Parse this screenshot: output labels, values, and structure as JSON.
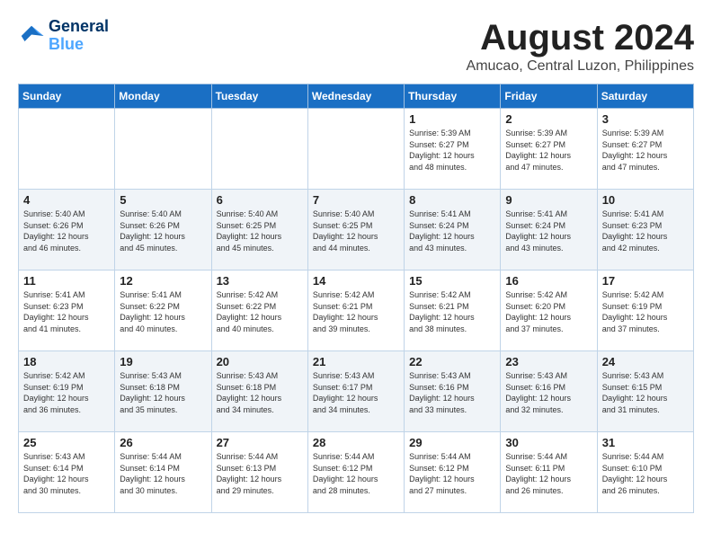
{
  "logo": {
    "line1": "General",
    "line2": "Blue"
  },
  "title": "August 2024",
  "subtitle": "Amucao, Central Luzon, Philippines",
  "headers": [
    "Sunday",
    "Monday",
    "Tuesday",
    "Wednesday",
    "Thursday",
    "Friday",
    "Saturday"
  ],
  "weeks": [
    [
      {
        "day": "",
        "info": ""
      },
      {
        "day": "",
        "info": ""
      },
      {
        "day": "",
        "info": ""
      },
      {
        "day": "",
        "info": ""
      },
      {
        "day": "1",
        "info": "Sunrise: 5:39 AM\nSunset: 6:27 PM\nDaylight: 12 hours\nand 48 minutes."
      },
      {
        "day": "2",
        "info": "Sunrise: 5:39 AM\nSunset: 6:27 PM\nDaylight: 12 hours\nand 47 minutes."
      },
      {
        "day": "3",
        "info": "Sunrise: 5:39 AM\nSunset: 6:27 PM\nDaylight: 12 hours\nand 47 minutes."
      }
    ],
    [
      {
        "day": "4",
        "info": "Sunrise: 5:40 AM\nSunset: 6:26 PM\nDaylight: 12 hours\nand 46 minutes."
      },
      {
        "day": "5",
        "info": "Sunrise: 5:40 AM\nSunset: 6:26 PM\nDaylight: 12 hours\nand 45 minutes."
      },
      {
        "day": "6",
        "info": "Sunrise: 5:40 AM\nSunset: 6:25 PM\nDaylight: 12 hours\nand 45 minutes."
      },
      {
        "day": "7",
        "info": "Sunrise: 5:40 AM\nSunset: 6:25 PM\nDaylight: 12 hours\nand 44 minutes."
      },
      {
        "day": "8",
        "info": "Sunrise: 5:41 AM\nSunset: 6:24 PM\nDaylight: 12 hours\nand 43 minutes."
      },
      {
        "day": "9",
        "info": "Sunrise: 5:41 AM\nSunset: 6:24 PM\nDaylight: 12 hours\nand 43 minutes."
      },
      {
        "day": "10",
        "info": "Sunrise: 5:41 AM\nSunset: 6:23 PM\nDaylight: 12 hours\nand 42 minutes."
      }
    ],
    [
      {
        "day": "11",
        "info": "Sunrise: 5:41 AM\nSunset: 6:23 PM\nDaylight: 12 hours\nand 41 minutes."
      },
      {
        "day": "12",
        "info": "Sunrise: 5:41 AM\nSunset: 6:22 PM\nDaylight: 12 hours\nand 40 minutes."
      },
      {
        "day": "13",
        "info": "Sunrise: 5:42 AM\nSunset: 6:22 PM\nDaylight: 12 hours\nand 40 minutes."
      },
      {
        "day": "14",
        "info": "Sunrise: 5:42 AM\nSunset: 6:21 PM\nDaylight: 12 hours\nand 39 minutes."
      },
      {
        "day": "15",
        "info": "Sunrise: 5:42 AM\nSunset: 6:21 PM\nDaylight: 12 hours\nand 38 minutes."
      },
      {
        "day": "16",
        "info": "Sunrise: 5:42 AM\nSunset: 6:20 PM\nDaylight: 12 hours\nand 37 minutes."
      },
      {
        "day": "17",
        "info": "Sunrise: 5:42 AM\nSunset: 6:19 PM\nDaylight: 12 hours\nand 37 minutes."
      }
    ],
    [
      {
        "day": "18",
        "info": "Sunrise: 5:42 AM\nSunset: 6:19 PM\nDaylight: 12 hours\nand 36 minutes."
      },
      {
        "day": "19",
        "info": "Sunrise: 5:43 AM\nSunset: 6:18 PM\nDaylight: 12 hours\nand 35 minutes."
      },
      {
        "day": "20",
        "info": "Sunrise: 5:43 AM\nSunset: 6:18 PM\nDaylight: 12 hours\nand 34 minutes."
      },
      {
        "day": "21",
        "info": "Sunrise: 5:43 AM\nSunset: 6:17 PM\nDaylight: 12 hours\nand 34 minutes."
      },
      {
        "day": "22",
        "info": "Sunrise: 5:43 AM\nSunset: 6:16 PM\nDaylight: 12 hours\nand 33 minutes."
      },
      {
        "day": "23",
        "info": "Sunrise: 5:43 AM\nSunset: 6:16 PM\nDaylight: 12 hours\nand 32 minutes."
      },
      {
        "day": "24",
        "info": "Sunrise: 5:43 AM\nSunset: 6:15 PM\nDaylight: 12 hours\nand 31 minutes."
      }
    ],
    [
      {
        "day": "25",
        "info": "Sunrise: 5:43 AM\nSunset: 6:14 PM\nDaylight: 12 hours\nand 30 minutes."
      },
      {
        "day": "26",
        "info": "Sunrise: 5:44 AM\nSunset: 6:14 PM\nDaylight: 12 hours\nand 30 minutes."
      },
      {
        "day": "27",
        "info": "Sunrise: 5:44 AM\nSunset: 6:13 PM\nDaylight: 12 hours\nand 29 minutes."
      },
      {
        "day": "28",
        "info": "Sunrise: 5:44 AM\nSunset: 6:12 PM\nDaylight: 12 hours\nand 28 minutes."
      },
      {
        "day": "29",
        "info": "Sunrise: 5:44 AM\nSunset: 6:12 PM\nDaylight: 12 hours\nand 27 minutes."
      },
      {
        "day": "30",
        "info": "Sunrise: 5:44 AM\nSunset: 6:11 PM\nDaylight: 12 hours\nand 26 minutes."
      },
      {
        "day": "31",
        "info": "Sunrise: 5:44 AM\nSunset: 6:10 PM\nDaylight: 12 hours\nand 26 minutes."
      }
    ]
  ]
}
